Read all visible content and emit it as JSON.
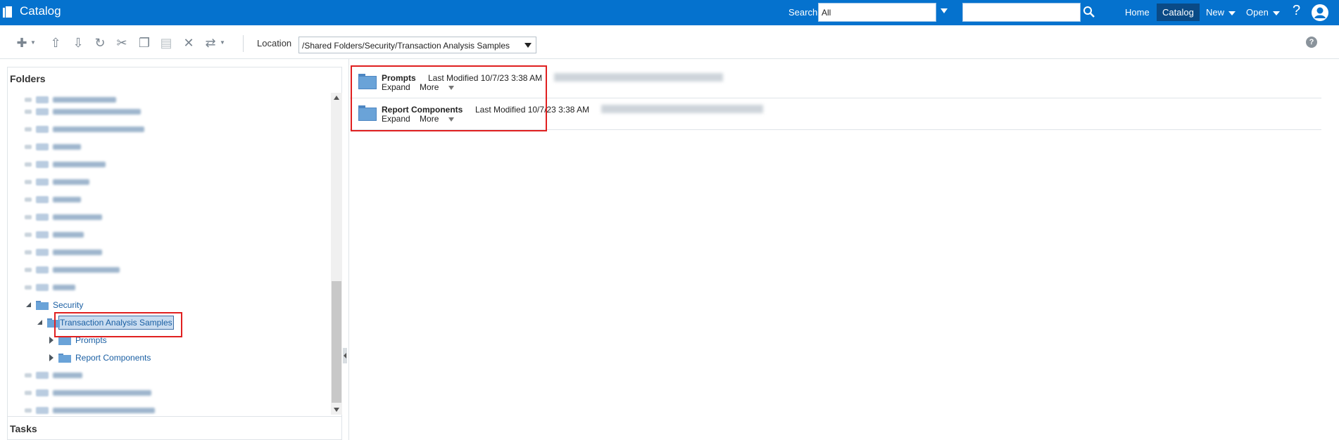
{
  "header": {
    "app_title": "Catalog",
    "search_label": "Search",
    "search_scope": "All",
    "search_value": "",
    "nav": {
      "home": "Home",
      "catalog": "Catalog",
      "new": "New",
      "open": "Open",
      "help": "?"
    }
  },
  "toolbar": {
    "icons": [
      "new-icon",
      "upload-icon",
      "download-icon",
      "refresh-icon",
      "cut-icon",
      "copy-icon",
      "paste-icon",
      "delete-icon",
      "switch-icon"
    ],
    "location_label": "Location",
    "location_value": "/Shared Folders/Security/Transaction Analysis Samples",
    "help": "?"
  },
  "folders_pane": {
    "title": "Folders",
    "tree": [
      {
        "label": "Security",
        "expanded": true
      },
      {
        "label": "Transaction Analysis Samples",
        "expanded": true,
        "selected": true
      },
      {
        "label": "Prompts",
        "expanded": false
      },
      {
        "label": "Report Components",
        "expanded": false
      }
    ]
  },
  "tasks_pane": {
    "title": "Tasks"
  },
  "items": [
    {
      "name": "Prompts",
      "modified": "Last Modified 10/7/23 3:38 AM",
      "expand": "Expand",
      "more": "More"
    },
    {
      "name": "Report Components",
      "modified": "Last Modified 10/7/23 3:38 AM",
      "expand": "Expand",
      "more": "More"
    }
  ],
  "colors": {
    "header_bg": "#0572ce",
    "catalog_active": "#0a4a86",
    "highlight": "#e02020",
    "folder": "#6aa3d8"
  }
}
